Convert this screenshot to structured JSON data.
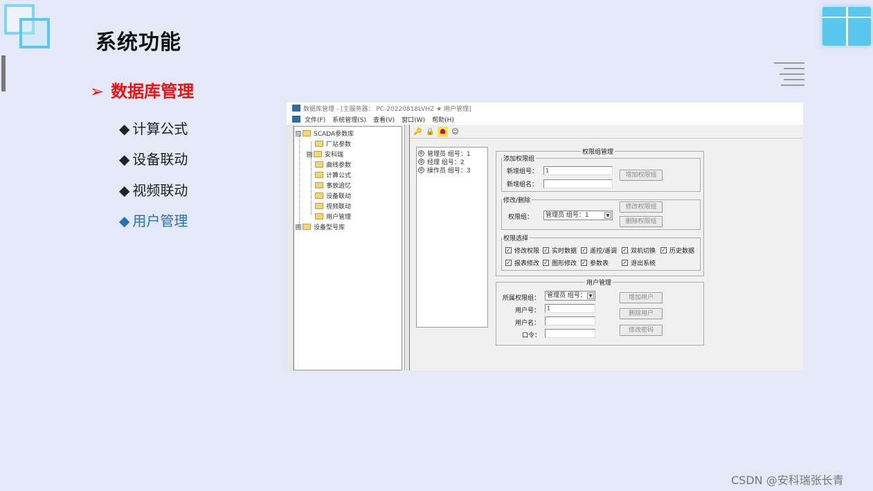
{
  "slide": {
    "title": "系统功能",
    "section": {
      "arrow": "➢",
      "label": "数据库管理"
    },
    "bullets": [
      {
        "marker": "◆",
        "label": "计算公式",
        "active": false
      },
      {
        "marker": "◆",
        "label": "设备联动",
        "active": false
      },
      {
        "marker": "◆",
        "label": "视频联动",
        "active": false
      },
      {
        "marker": "◆",
        "label": "用户管理",
        "active": true
      }
    ],
    "watermark": "CSDN @安科瑞张长青"
  },
  "app": {
    "window_title": "数据库管理 - [主服务器： PC-20220818LVHZ ★ 用户管理]",
    "menu": [
      "文件(F)",
      "系统管理(S)",
      "查看(V)",
      "窗口(W)",
      "帮助(H)"
    ],
    "toolbar_icons": [
      "key-icon",
      "lock-icon",
      "person-icon",
      "smiley-icon"
    ],
    "tree": {
      "root": {
        "toggle": "⊟",
        "label": "SCADA参数库"
      },
      "children": [
        {
          "toggle": "",
          "label": "厂站参数"
        },
        {
          "toggle": "⊞",
          "label": "安科瑞"
        },
        {
          "toggle": "",
          "label": "曲线参数"
        },
        {
          "toggle": "",
          "label": "计算公式"
        },
        {
          "toggle": "",
          "label": "事故追忆"
        },
        {
          "toggle": "",
          "label": "设备联动"
        },
        {
          "toggle": "",
          "label": "视频联动"
        },
        {
          "toggle": "",
          "label": "用户管理"
        }
      ],
      "root2": {
        "toggle": "⊞",
        "label": "设备型号库"
      }
    },
    "group_list": [
      "管理员 组号：1",
      "经理 组号：2",
      "操作员 组号：3"
    ],
    "perm_group_mgmt": {
      "title": "权限组管理",
      "add": {
        "legend": "添加权限组",
        "new_id_label": "新增组号：",
        "new_id_value": "1",
        "new_name_label": "新增组名：",
        "new_name_value": "",
        "add_button": "增加权限组"
      },
      "modify": {
        "legend": "修改/删除",
        "group_label": "权限组：",
        "group_value": "管理员 组号：1",
        "modify_button": "修改权限组",
        "delete_button": "删除权限组"
      },
      "select": {
        "legend": "权限选择",
        "checkbox_mark": "✓",
        "row1": [
          "修改权限",
          "实时数据",
          "遥控/遥调",
          "双机切换",
          "历史数据"
        ],
        "row2": [
          "报表修改",
          "图形修改",
          "参数表",
          "退出系统"
        ]
      }
    },
    "user_mgmt": {
      "title": "用户管理",
      "group_label": "所属权限组：",
      "group_value": "管理员 组号：",
      "user_id_label": "用户号：",
      "user_id_value": "1",
      "user_name_label": "用户名：",
      "user_name_value": "",
      "password_label": "口令：",
      "password_value": "",
      "add_button": "增加用户",
      "delete_button": "删除用户",
      "change_pwd_button": "修改密码"
    }
  }
}
